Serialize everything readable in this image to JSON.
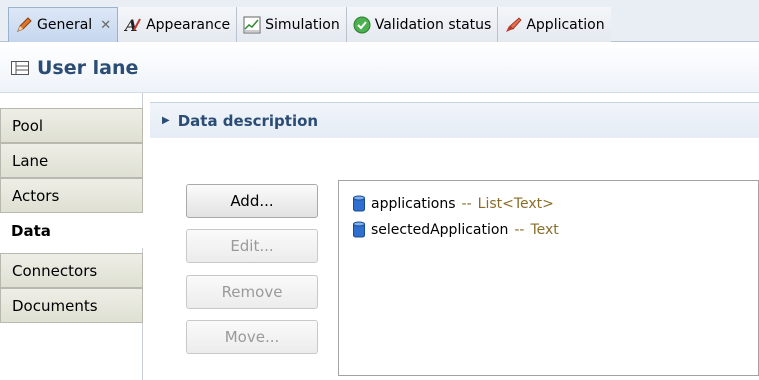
{
  "tabs": [
    {
      "label": "General",
      "icon": "pencil-icon",
      "active": true,
      "closable": true
    },
    {
      "label": "Appearance",
      "icon": "appearance-icon"
    },
    {
      "label": "Simulation",
      "icon": "chart-icon"
    },
    {
      "label": "Validation status",
      "icon": "check-circle-icon"
    },
    {
      "label": "Application",
      "icon": "brush-icon"
    }
  ],
  "header": {
    "title": "User lane",
    "icon": "lane-icon"
  },
  "nav": {
    "items": [
      {
        "label": "Pool"
      },
      {
        "label": "Lane"
      },
      {
        "label": "Actors"
      },
      {
        "label": "Data",
        "active": true
      },
      {
        "label": "Connectors"
      },
      {
        "label": "Documents"
      }
    ]
  },
  "section": {
    "title": "Data description"
  },
  "buttons": {
    "add": "Add...",
    "edit": "Edit...",
    "remove": "Remove",
    "move": "Move..."
  },
  "data_list": [
    {
      "name": "applications",
      "sep": "--",
      "type": "List<Text>"
    },
    {
      "name": "selectedApplication",
      "sep": "--",
      "type": "Text"
    }
  ],
  "colors": {
    "accent": "#2b4d75",
    "type_text": "#8a6d2a",
    "db_icon": "#2f6fcf"
  }
}
